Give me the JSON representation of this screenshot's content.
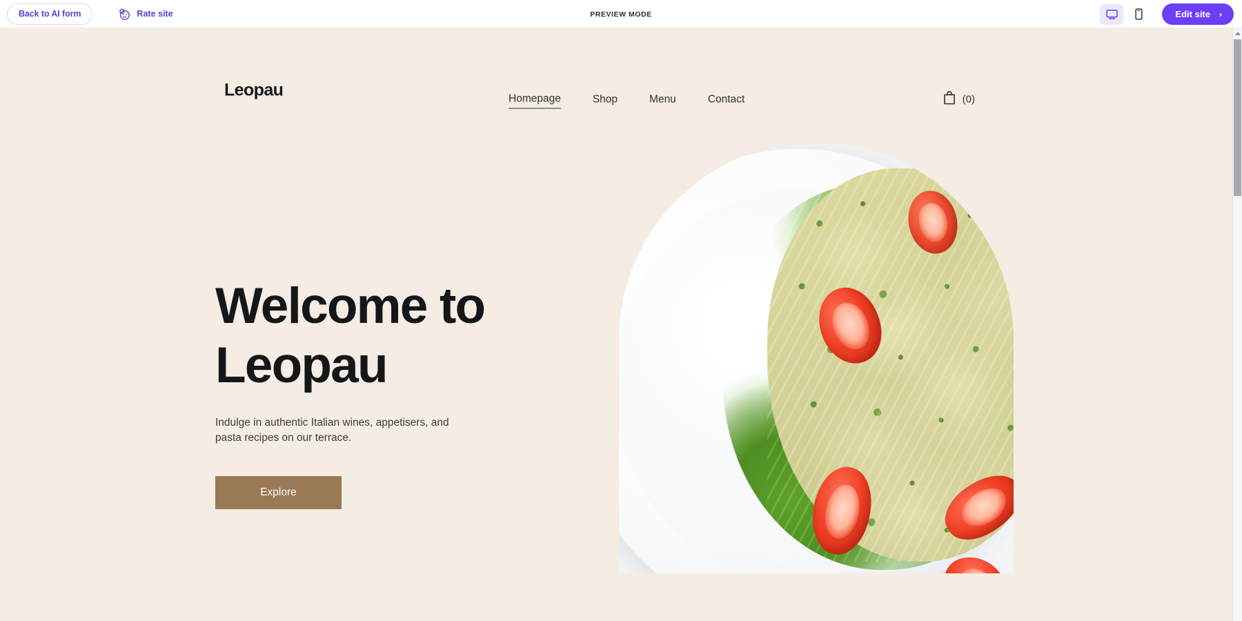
{
  "preview_bar": {
    "back_button": "Back to AI form",
    "rate_site": "Rate site",
    "rate_icon": "smiley-rate-icon",
    "mode_label": "PREVIEW MODE",
    "desktop_icon": "desktop-monitor-icon",
    "mobile_icon": "mobile-phone-icon",
    "edit_button": "Edit site",
    "edit_chevron": "›",
    "accent_color": "#6c3ef4",
    "accent_soft_color": "#ece7fd",
    "link_color": "#5b3fd6"
  },
  "site": {
    "background_color": "#f5ece3",
    "brand": "Leopau",
    "nav": [
      {
        "label": "Homepage",
        "active": true
      },
      {
        "label": "Shop",
        "active": false
      },
      {
        "label": "Menu",
        "active": false
      },
      {
        "label": "Contact",
        "active": false
      }
    ],
    "cart": {
      "icon": "shopping-bag-icon",
      "count_label": "(0)"
    },
    "hero": {
      "title": "Welcome to\nLeopau",
      "subtitle": "Indulge in authentic Italian wines, appetisers, and\npasta recipes on our terrace.",
      "cta_label": "Explore",
      "cta_color": "#9a7a55",
      "image_alt": "pesto-farfalle-pasta-salad-photo"
    }
  },
  "scrollbar": {
    "up_arrow": "scroll-up-arrow",
    "thumb": "scroll-thumb"
  }
}
